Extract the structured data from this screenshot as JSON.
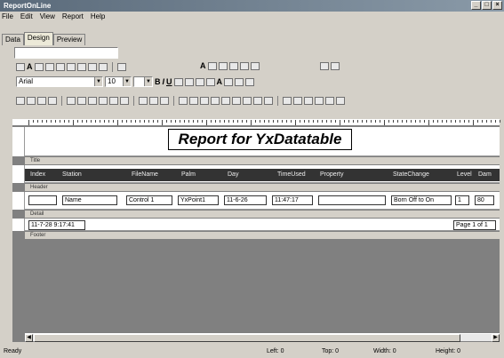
{
  "window": {
    "title": "ReportOnLine",
    "buttons": [
      "_",
      "□",
      "×"
    ]
  },
  "menu": [
    "File",
    "Edit",
    "View",
    "Report",
    "Help"
  ],
  "tabs": [
    "Data",
    "Design",
    "Preview"
  ],
  "active_tab": "Design",
  "toolbar": {
    "font_name": "Arial",
    "font_size": "10"
  },
  "report": {
    "title": "Report for YxDatatable",
    "band_labels": {
      "title": "Title",
      "header": "Header",
      "detail": "Detail",
      "footer": "Footer"
    },
    "columns": [
      "Index",
      "Station",
      "FileName",
      "Palm",
      "Day",
      "TimeUsed",
      "Property",
      "StateChange",
      "Level",
      "Dam"
    ],
    "detail_fields": [
      "",
      "Name",
      "Control 1",
      "YxPoint1",
      "11-6-26",
      "11:47:17",
      "",
      "Born Off to On",
      "1",
      "80"
    ],
    "footer_left": "11-7-28 9:17:41",
    "footer_right": "Page 1 of 1"
  },
  "status": {
    "ready": "Ready",
    "left": "Left: 0",
    "top": "Top: 0",
    "width": "Width: 0",
    "height": "Height: 0"
  },
  "colors": {
    "header_band": "#333333",
    "titlebar": "#5a6a7a",
    "workspace": "#808080"
  }
}
